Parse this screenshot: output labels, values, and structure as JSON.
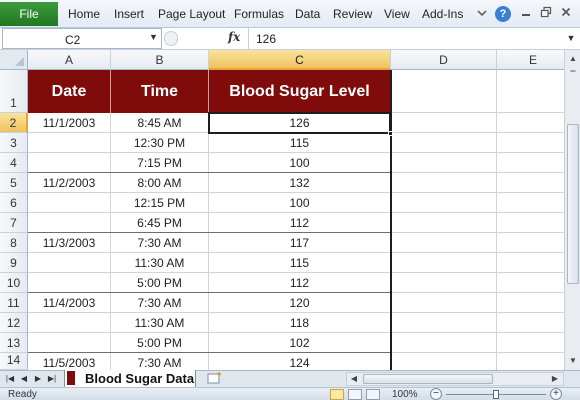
{
  "ribbon": {
    "file_label": "File",
    "tabs": [
      "Home",
      "Insert",
      "Page Layout",
      "Formulas",
      "Data",
      "Review",
      "View",
      "Add-Ins"
    ],
    "icons": [
      "minimize-ribbon-icon",
      "help-icon",
      "window-minimize-icon",
      "window-restore-icon",
      "window-close-icon"
    ],
    "help_glyph": "?"
  },
  "formula_bar": {
    "name_box": "C2",
    "fx_label": "fx",
    "formula": "126"
  },
  "columns": [
    "A",
    "B",
    "C",
    "D",
    "E"
  ],
  "active_column": "C",
  "rows": [
    "1",
    "2",
    "3",
    "4",
    "5",
    "6",
    "7",
    "8",
    "9",
    "10",
    "11",
    "12",
    "13",
    "14"
  ],
  "active_row": "2",
  "table": {
    "headers": [
      "Date",
      "Time",
      "Blood Sugar Level"
    ],
    "header_color": "#7f0b0b",
    "records": [
      {
        "date": "11/1/2003",
        "time": "8:45 AM",
        "level": "126"
      },
      {
        "date": "",
        "time": "12:30 PM",
        "level": "115"
      },
      {
        "date": "",
        "time": "7:15 PM",
        "level": "100"
      },
      {
        "date": "11/2/2003",
        "time": "8:00 AM",
        "level": "132"
      },
      {
        "date": "",
        "time": "12:15 PM",
        "level": "100"
      },
      {
        "date": "",
        "time": "6:45 PM",
        "level": "112"
      },
      {
        "date": "11/3/2003",
        "time": "7:30 AM",
        "level": "117"
      },
      {
        "date": "",
        "time": "11:30 AM",
        "level": "115"
      },
      {
        "date": "",
        "time": "5:00 PM",
        "level": "112"
      },
      {
        "date": "11/4/2003",
        "time": "7:30 AM",
        "level": "120"
      },
      {
        "date": "",
        "time": "11:30 AM",
        "level": "118"
      },
      {
        "date": "",
        "time": "5:00 PM",
        "level": "102"
      },
      {
        "date": "11/5/2003",
        "time": "7:30 AM",
        "level": "124"
      }
    ]
  },
  "sheet": {
    "tab_label": "Blood Sugar Data",
    "tab_color": "#7f0b0b"
  },
  "status": {
    "ready": "Ready",
    "zoom": "100%",
    "zoom_level_pct": 50
  }
}
